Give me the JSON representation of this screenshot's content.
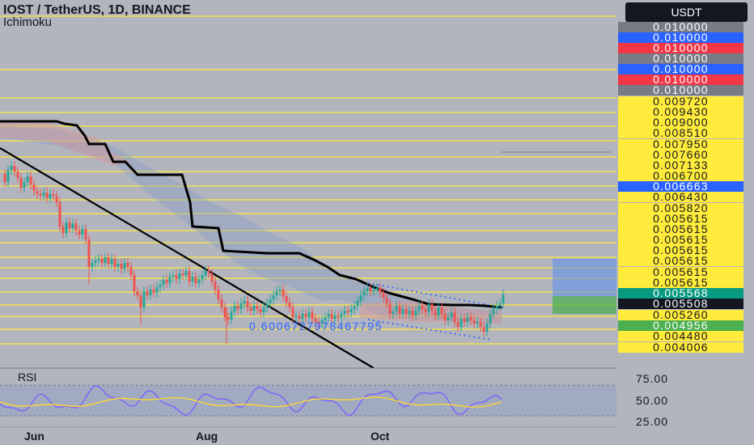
{
  "chart": {
    "title": "IOST / TetherUS, 1D, BINANCE",
    "indicator": "Ichimoku",
    "currency": "USDT",
    "rsi_label": "RSI",
    "fib_label": "0.6006727978467795",
    "colors": {
      "background": "#b2b5be",
      "level_line": "#ffeb3b",
      "trendline": "#000000",
      "up": "#26a69a",
      "down": "#ef5350",
      "cloud_up": "#7e96c8",
      "cloud_down": "#d79a9a",
      "rsi_line": "#7b61ff",
      "rsi_ma": "#fdd835"
    }
  },
  "price_labels": [
    {
      "text": "0.010000",
      "bg": "#787b86",
      "fg": "#ffffff"
    },
    {
      "text": "0.010000",
      "bg": "#2962ff",
      "fg": "#ffffff"
    },
    {
      "text": "0.010000",
      "bg": "#f23645",
      "fg": "#ffffff"
    },
    {
      "text": "0.010000",
      "bg": "#787b86",
      "fg": "#ffffff"
    },
    {
      "text": "0.010000",
      "bg": "#2962ff",
      "fg": "#ffffff"
    },
    {
      "text": "0.010000",
      "bg": "#f23645",
      "fg": "#ffffff"
    },
    {
      "text": "0.010000",
      "bg": "#787b86",
      "fg": "#ffffff"
    },
    {
      "text": "0.009720",
      "bg": "#ffeb3b",
      "fg": "#131722"
    },
    {
      "text": "0.009430",
      "bg": "#ffeb3b",
      "fg": "#131722"
    },
    {
      "text": "0.009000",
      "bg": "#ffeb3b",
      "fg": "#131722"
    },
    {
      "text": "0.008510",
      "bg": "#ffeb3b",
      "fg": "#131722"
    },
    {
      "text": "0.007950",
      "bg": "#ffeb3b",
      "fg": "#131722"
    },
    {
      "text": "0.007660",
      "bg": "#ffeb3b",
      "fg": "#131722"
    },
    {
      "text": "0.007133",
      "bg": "#ffeb3b",
      "fg": "#131722"
    },
    {
      "text": "0.006700",
      "bg": "#ffeb3b",
      "fg": "#131722"
    },
    {
      "text": "0.006663",
      "bg": "#2962ff",
      "fg": "#ffffff"
    },
    {
      "text": "0.006430",
      "bg": "#ffeb3b",
      "fg": "#131722"
    },
    {
      "text": "0.005820",
      "bg": "#ffeb3b",
      "fg": "#131722"
    },
    {
      "text": "0.005615",
      "bg": "#ffeb3b",
      "fg": "#131722"
    },
    {
      "text": "0.005615",
      "bg": "#ffeb3b",
      "fg": "#131722"
    },
    {
      "text": "0.005615",
      "bg": "#ffeb3b",
      "fg": "#131722"
    },
    {
      "text": "0.005615",
      "bg": "#ffeb3b",
      "fg": "#131722"
    },
    {
      "text": "0.005615",
      "bg": "#ffeb3b",
      "fg": "#131722"
    },
    {
      "text": "0.005615",
      "bg": "#ffeb3b",
      "fg": "#131722"
    },
    {
      "text": "0.005615",
      "bg": "#ffeb3b",
      "fg": "#131722"
    },
    {
      "text": "0.005568",
      "bg": "#089981",
      "fg": "#ffffff"
    },
    {
      "text": "0.005508",
      "bg": "#131722",
      "fg": "#ffffff"
    },
    {
      "text": "0.005260",
      "bg": "#ffeb3b",
      "fg": "#131722"
    },
    {
      "text": "0.004956",
      "bg": "#4caf50",
      "fg": "#ffffff"
    },
    {
      "text": "0.004480",
      "bg": "#ffeb3b",
      "fg": "#131722"
    },
    {
      "text": "0.004006",
      "bg": "#ffeb3b",
      "fg": "#131722"
    }
  ],
  "rsi_axis": [
    "75.00",
    "50.00",
    "25.00"
  ],
  "time_axis": [
    "Jun",
    "Aug",
    "Oct"
  ]
}
